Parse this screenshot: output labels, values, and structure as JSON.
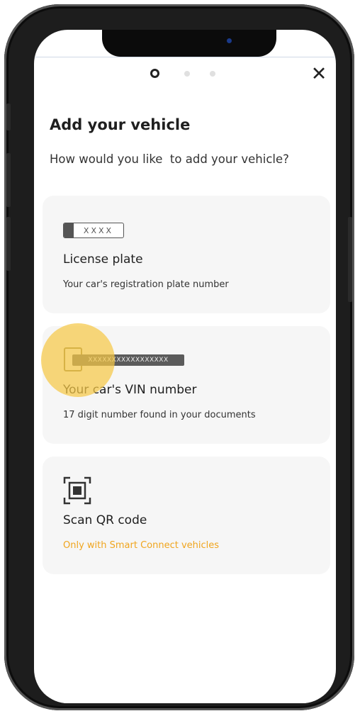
{
  "header": {
    "pager": {
      "total": 3,
      "active": 1
    },
    "close_label": "✕"
  },
  "page": {
    "title": "Add your vehicle",
    "subtitle": "How would you like  to add your vehicle?"
  },
  "options": [
    {
      "icon": "license-plate-icon",
      "icon_text": "XXXX",
      "title": "License plate",
      "description": "Your car's registration plate number"
    },
    {
      "icon": "vin-document-icon",
      "icon_text": "XXXXXXXXXXXXXXXXX",
      "title": "Your car's VIN number",
      "description": "17 digit number found in your documents"
    },
    {
      "icon": "qr-scan-icon",
      "title": "Scan QR code",
      "description": "Only with Smart Connect vehicles"
    }
  ],
  "colors": {
    "accent": "#f0a51e",
    "card_background": "#f6f6f6",
    "tap_indicator": "#f5c846"
  }
}
